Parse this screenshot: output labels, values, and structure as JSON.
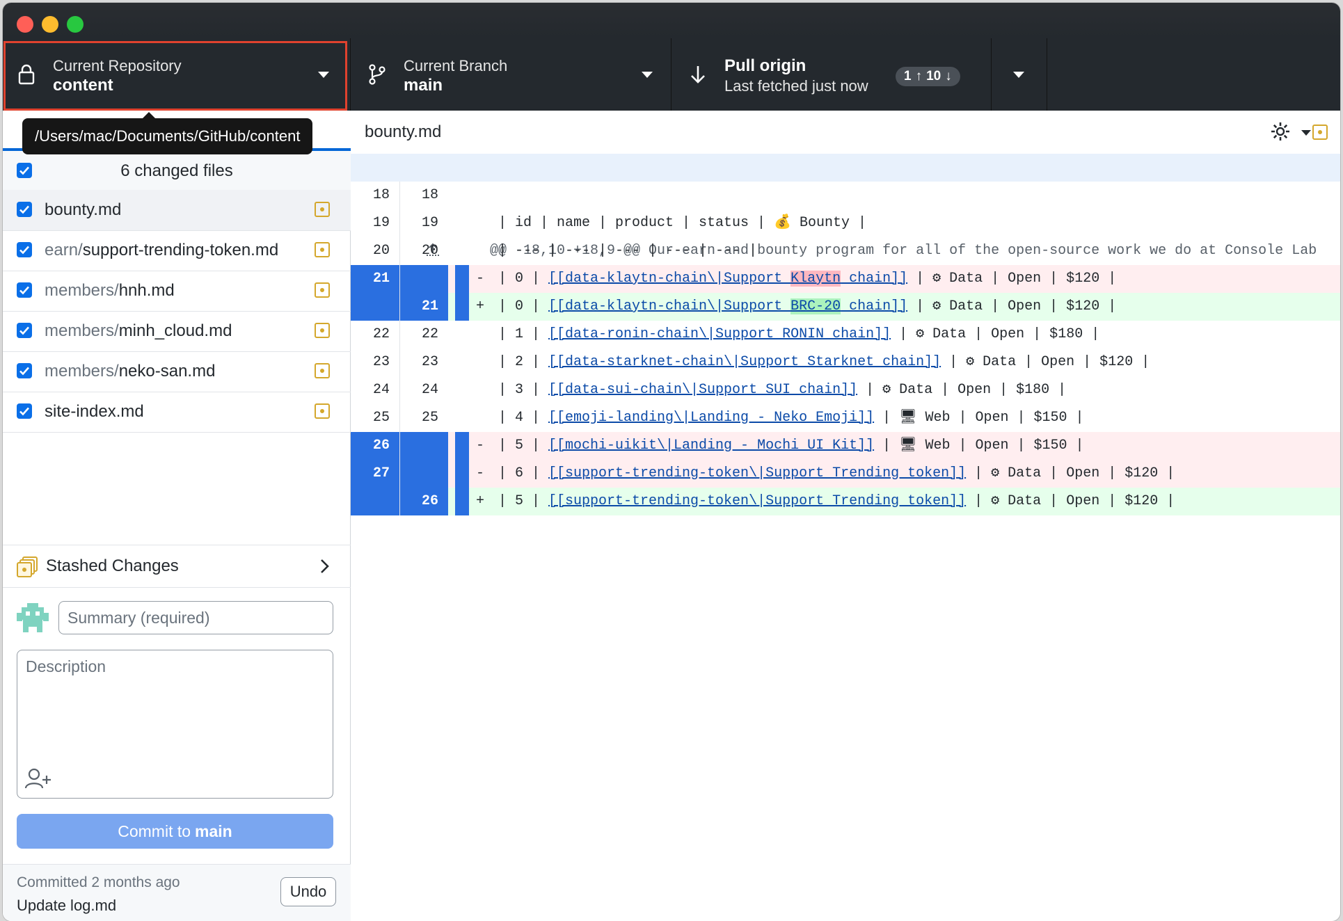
{
  "toolbar": {
    "repo_label": "Current Repository",
    "repo_name": "content",
    "branch_label": "Current Branch",
    "branch_name": "main",
    "pull_label": "Pull origin",
    "pull_status": "Last fetched just now",
    "ahead": "1",
    "behind": "10"
  },
  "tooltip": {
    "path": "/Users/mac/Documents/GitHub/content"
  },
  "changes": {
    "count_label": "6 changed files",
    "files": [
      {
        "dir": "",
        "name": "bounty.md"
      },
      {
        "dir": "earn/",
        "name": "support-trending-token.md"
      },
      {
        "dir": "members/",
        "name": "hnh.md"
      },
      {
        "dir": "members/",
        "name": "minh_cloud.md"
      },
      {
        "dir": "members/",
        "name": "neko-san.md"
      },
      {
        "dir": "",
        "name": "site-index.md"
      }
    ]
  },
  "stash": {
    "label": "Stashed Changes"
  },
  "commit": {
    "summary_placeholder": "Summary (required)",
    "description_placeholder": "Description",
    "button_prefix": "Commit to",
    "button_branch": "main"
  },
  "last_commit": {
    "time": "Committed 2 months ago",
    "message": "Update log.md",
    "undo_label": "Undo"
  },
  "diff": {
    "file_name": "bounty.md",
    "hunk_header": "@@ -18,10 +18,9 @@ Our earn and bounty program for all of the open-source work we do at Console Lab",
    "lines": [
      {
        "old": "18",
        "new": "18",
        "sign": "",
        "text": ""
      },
      {
        "old": "19",
        "new": "19",
        "sign": "",
        "text": "| id | name | product | status | 💰 Bounty |"
      },
      {
        "old": "20",
        "new": "20",
        "sign": "",
        "text": "| --- | --- | --- | --- | --- |"
      },
      {
        "old": "21",
        "new": "",
        "sign": "-",
        "pre": "| 0 | ",
        "link_a": "[[data-klaytn-chain\\|Support ",
        "link_hl": "Klaytn",
        "link_b": " chain]]",
        "post": " | ⚙ Data | Open | $120 |"
      },
      {
        "old": "",
        "new": "21",
        "sign": "+",
        "pre": "| 0 | ",
        "link_a": "[[data-klaytn-chain\\|Support ",
        "link_hl": "BRC-20",
        "link_b": " chain]]",
        "post": " | ⚙ Data | Open | $120 |"
      },
      {
        "old": "22",
        "new": "22",
        "sign": "",
        "pre": "| 1 | ",
        "link_a": "[[data-ronin-chain\\|Support RONIN chain]]",
        "post": " | ⚙ Data | Open | $180 |"
      },
      {
        "old": "23",
        "new": "23",
        "sign": "",
        "pre": "| 2 | ",
        "link_a": "[[data-starknet-chain\\|Support Starknet chain]]",
        "post": " | ⚙ Data | Open | $120 |"
      },
      {
        "old": "24",
        "new": "24",
        "sign": "",
        "pre": "| 3 | ",
        "link_a": "[[data-sui-chain\\|Support SUI chain]]",
        "post": " | ⚙ Data | Open | $180 |"
      },
      {
        "old": "25",
        "new": "25",
        "sign": "",
        "pre": "| 4 | ",
        "link_a": "[[emoji-landing\\|Landing - Neko Emoji]]",
        "post": " | 🖥 Web | Open | $150 |"
      },
      {
        "old": "26",
        "new": "",
        "sign": "-",
        "pre": "| 5 | ",
        "link_a": "[[mochi-uikit\\|Landing - Mochi UI Kit]]",
        "post": " | 🖥 Web | Open | $150 |"
      },
      {
        "old": "27",
        "new": "",
        "sign": "-",
        "pre": "| 6 | ",
        "link_a": "[[support-trending-token\\|Support Trending token]]",
        "post": " | ⚙ Data | Open | $120 |"
      },
      {
        "old": "",
        "new": "26",
        "sign": "+",
        "pre": "| 5 | ",
        "link_a": "[[support-trending-token\\|Support Trending token]]",
        "post": " | ⚙ Data | Open | $120 |"
      }
    ]
  },
  "colors": {
    "accent": "#0a6fe8",
    "toolbar_bg": "#24292e",
    "repo_outline": "#e0422e",
    "deleted_bg": "#ffeef0",
    "added_bg": "#e6ffec",
    "modified_icon": "#d4a72c"
  }
}
